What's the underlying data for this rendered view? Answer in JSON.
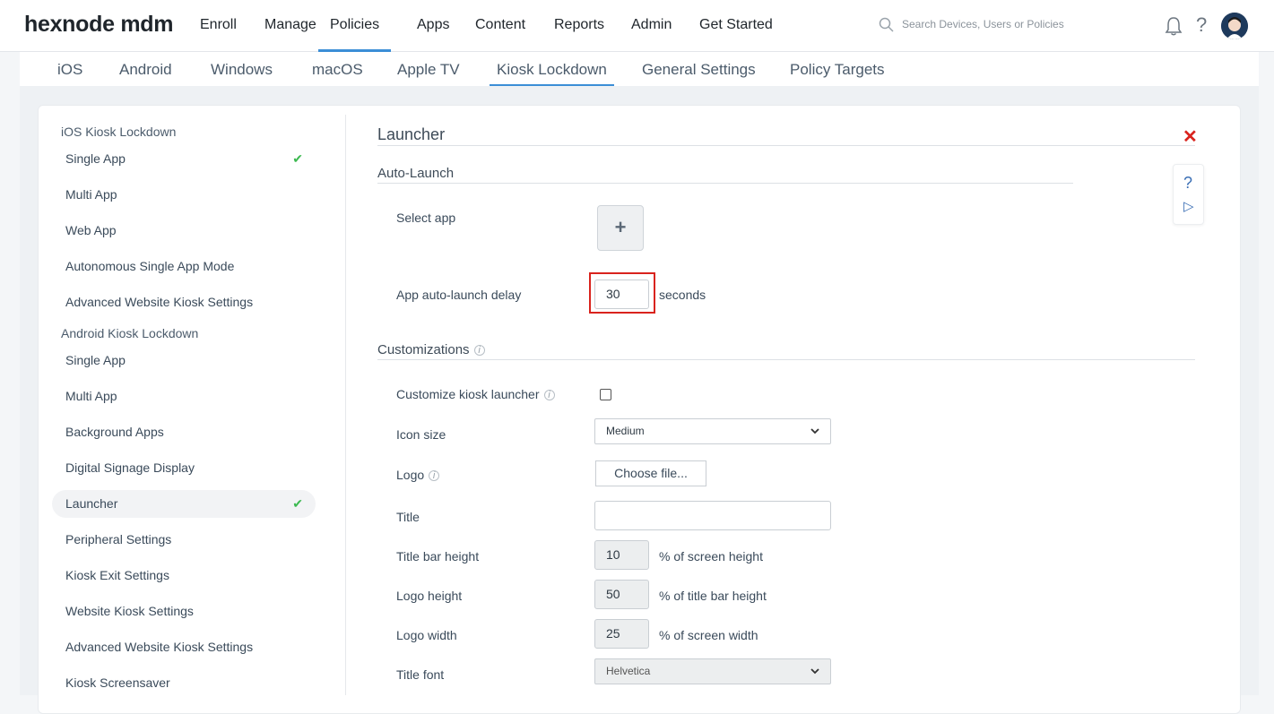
{
  "brand": "hexnode mdm",
  "nav": [
    "Enroll",
    "Manage",
    "Policies",
    "Apps",
    "Content",
    "Reports",
    "Admin",
    "Get Started"
  ],
  "search": {
    "placeholder": "Search Devices, Users or Policies"
  },
  "subtabs": [
    "iOS",
    "Android",
    "Windows",
    "macOS",
    "Apple TV",
    "Kiosk Lockdown",
    "General Settings",
    "Policy Targets"
  ],
  "sidebar": {
    "ios_header": "iOS Kiosk Lockdown",
    "ios_items": [
      "Single App",
      "Multi App",
      "Web App",
      "Autonomous Single App Mode",
      "Advanced Website Kiosk Settings"
    ],
    "android_header": "Android Kiosk Lockdown",
    "android_items": [
      "Single App",
      "Multi App",
      "Background Apps",
      "Digital Signage Display",
      "Launcher",
      "Peripheral Settings",
      "Kiosk Exit Settings",
      "Website Kiosk Settings",
      "Advanced Website Kiosk Settings",
      "Kiosk Screensaver"
    ],
    "check": "✔"
  },
  "main": {
    "title": "Launcher",
    "close": "✕",
    "auto_launch": {
      "title": "Auto-Launch",
      "select_app_label": "Select app",
      "add_symbol": "+",
      "delay_label": "App auto-launch delay",
      "delay_value": "30",
      "delay_unit": "seconds"
    },
    "customizations": {
      "title": "Customizations",
      "info": "i",
      "customize_label": "Customize kiosk launcher",
      "icon_size_label": "Icon size",
      "icon_size_value": "Medium",
      "logo_label": "Logo",
      "choose_file": "Choose file...",
      "title_label": "Title",
      "title_value": "",
      "title_bar_height_label": "Title bar height",
      "title_bar_height_value": "10",
      "title_bar_height_unit": "% of screen height",
      "logo_height_label": "Logo height",
      "logo_height_value": "50",
      "logo_height_unit": "% of title bar height",
      "logo_width_label": "Logo width",
      "logo_width_value": "25",
      "logo_width_unit": "% of screen width",
      "title_font_label": "Title font",
      "title_font_value": "Helvetica"
    },
    "help": {
      "question": "?",
      "play": "▷"
    }
  }
}
